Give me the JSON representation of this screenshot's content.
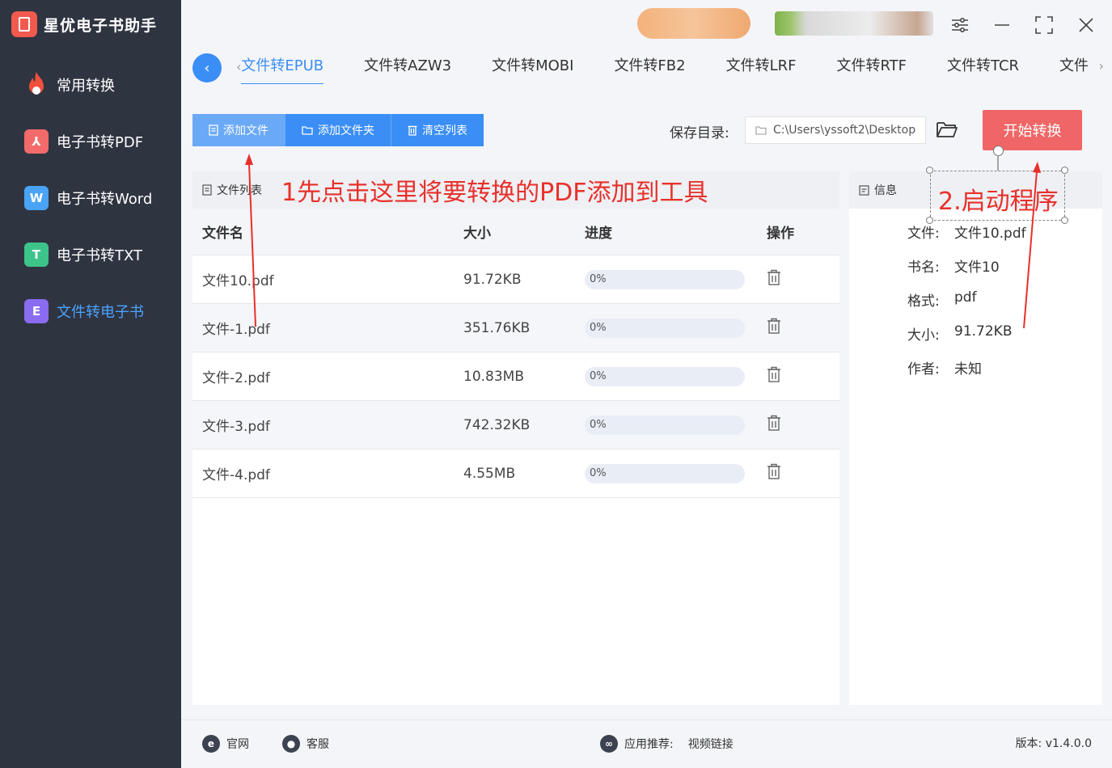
{
  "app": {
    "name": "星优电子书助手"
  },
  "sidebar": {
    "items": [
      {
        "label": "常用转换",
        "icon": "fire-icon",
        "color": "#f0503c",
        "glyph": ""
      },
      {
        "label": "电子书转PDF",
        "icon": "pdf-icon",
        "color": "#f26a6a",
        "glyph": "⅄"
      },
      {
        "label": "电子书转Word",
        "icon": "word-icon",
        "color": "#4aa3f5",
        "glyph": "W"
      },
      {
        "label": "电子书转TXT",
        "icon": "txt-icon",
        "color": "#3cc48a",
        "glyph": "T"
      },
      {
        "label": "文件转电子书",
        "icon": "ebook-icon",
        "color": "#8a6cf0",
        "glyph": "E"
      }
    ],
    "active_index": 4
  },
  "tabs": {
    "items": [
      "文件转EPUB",
      "文件转AZW3",
      "文件转MOBI",
      "文件转FB2",
      "文件转LRF",
      "文件转RTF",
      "文件转TCR",
      "文件"
    ],
    "active_index": 0
  },
  "toolbar": {
    "add_file": "添加文件",
    "add_folder": "添加文件夹",
    "clear_list": "清空列表",
    "save_label": "保存目录:",
    "save_path": "C:\\Users\\yssoft2\\Desktop",
    "start": "开始转换"
  },
  "file_list": {
    "title": "文件列表",
    "columns": {
      "name": "文件名",
      "size": "大小",
      "progress": "进度",
      "action": "操作"
    },
    "rows": [
      {
        "name": "文件10.pdf",
        "size": "91.72KB",
        "progress": "0%",
        "progress_value": 0
      },
      {
        "name": "文件-1.pdf",
        "size": "351.76KB",
        "progress": "0%",
        "progress_value": 0
      },
      {
        "name": "文件-2.pdf",
        "size": "10.83MB",
        "progress": "0%",
        "progress_value": 0
      },
      {
        "name": "文件-3.pdf",
        "size": "742.32KB",
        "progress": "0%",
        "progress_value": 0
      },
      {
        "name": "文件-4.pdf",
        "size": "4.55MB",
        "progress": "0%",
        "progress_value": 0
      }
    ]
  },
  "info": {
    "title": "信息",
    "fields": [
      {
        "key": "文件:",
        "value": "文件10.pdf"
      },
      {
        "key": "书名:",
        "value": "文件10"
      },
      {
        "key": "格式:",
        "value": "pdf"
      },
      {
        "key": "大小:",
        "value": "91.72KB"
      },
      {
        "key": "作者:",
        "value": "未知"
      }
    ]
  },
  "annotations": {
    "step1": "1先点击这里将要转换的PDF添加到工具",
    "step2": "2.启动程序",
    "color": "#e8302a"
  },
  "footer": {
    "website": "官网",
    "support": "客服",
    "recommend_label": "应用推荐:",
    "recommend_link": "视频链接",
    "version": "版本: v1.4.0.0"
  }
}
